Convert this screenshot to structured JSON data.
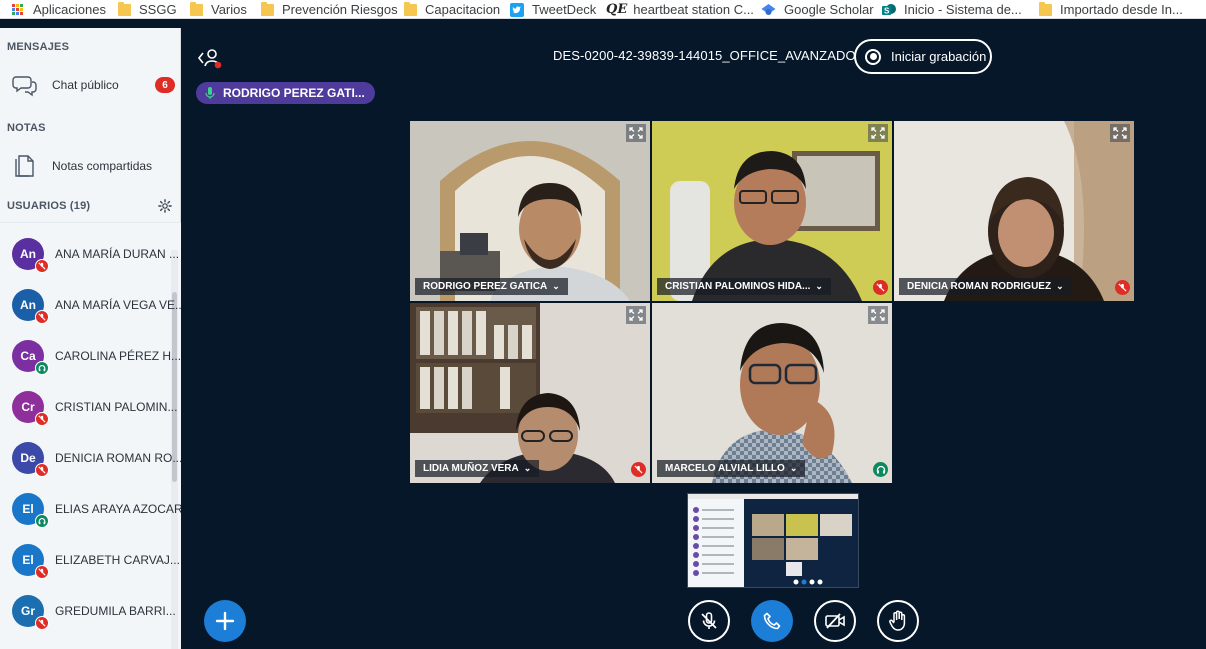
{
  "bookmarks": [
    {
      "label": "Aplicaciones",
      "icon": "apps-grid-icon"
    },
    {
      "label": "SSGG",
      "icon": "folder-icon"
    },
    {
      "label": "Varios",
      "icon": "folder-icon"
    },
    {
      "label": "Prevención Riesgos",
      "icon": "folder-icon"
    },
    {
      "label": "Capacitacion",
      "icon": "folder-icon"
    },
    {
      "label": "TweetDeck",
      "icon": "twitter-icon"
    },
    {
      "label": "heartbeat station C...",
      "icon": "qe-logo-icon"
    },
    {
      "label": "Google Scholar",
      "icon": "scholar-icon"
    },
    {
      "label": "Inicio - Sistema de...",
      "icon": "sharepoint-icon"
    },
    {
      "label": "Importado desde In...",
      "icon": "folder-icon"
    }
  ],
  "sidebar": {
    "messages_title": "MENSAJES",
    "public_chat_label": "Chat público",
    "public_chat_badge": "6",
    "notes_title": "NOTAS",
    "shared_notes_label": "Notas compartidas",
    "users_title": "USUARIOS (19)",
    "users": [
      {
        "initials": "An",
        "name": "ANA MARÍA DURAN ...",
        "color": "#5a2fa0",
        "status": "muted"
      },
      {
        "initials": "An",
        "name": "ANA MARÍA VEGA VE...",
        "color": "#1a5fa8",
        "status": "muted"
      },
      {
        "initials": "Ca",
        "name": "CAROLINA PÉREZ H...",
        "color": "#7b2fa0",
        "status": "listen"
      },
      {
        "initials": "Cr",
        "name": "CRISTIAN PALOMIN...",
        "color": "#8e2f9c",
        "status": "muted"
      },
      {
        "initials": "De",
        "name": "DENICIA ROMAN RO...",
        "color": "#3b4aa8",
        "status": "muted"
      },
      {
        "initials": "El",
        "name": "ELIAS ARAYA AZOCAR",
        "color": "#1976c8",
        "status": "listen"
      },
      {
        "initials": "El",
        "name": "ELIZABETH CARVAJ...",
        "color": "#1976c8",
        "status": "muted"
      },
      {
        "initials": "Gr",
        "name": "GREDUMILA BARRI...",
        "color": "#1b6fb0",
        "status": "muted"
      }
    ]
  },
  "main": {
    "meeting_title": "DES-0200-42-39839-144015_OFFICE_AVANZADO",
    "record_label": "Iniciar grabación",
    "talking_indicator": "RODRIGO PEREZ GATI...",
    "videos": [
      {
        "name": "RODRIGO PEREZ GATICA",
        "status": "none",
        "active": true
      },
      {
        "name": "CRISTIAN PALOMINOS HIDA...",
        "status": "muted",
        "active": false
      },
      {
        "name": "DENICIA ROMAN RODRIGUEZ",
        "status": "muted",
        "active": false
      },
      {
        "name": "LIDIA MUÑOZ VERA",
        "status": "muted",
        "active": false
      },
      {
        "name": "MARCELO ALVIAL LILLO",
        "status": "listen",
        "active": false
      }
    ],
    "controls": [
      "mic-muted-icon",
      "phone-icon",
      "camera-off-icon",
      "raise-hand-icon"
    ],
    "colors": {
      "background": "#06172a",
      "accent": "#1c7ed6",
      "muted": "#de2c26",
      "listen": "#0c8a5f",
      "talking": "#4e3b9c"
    }
  }
}
